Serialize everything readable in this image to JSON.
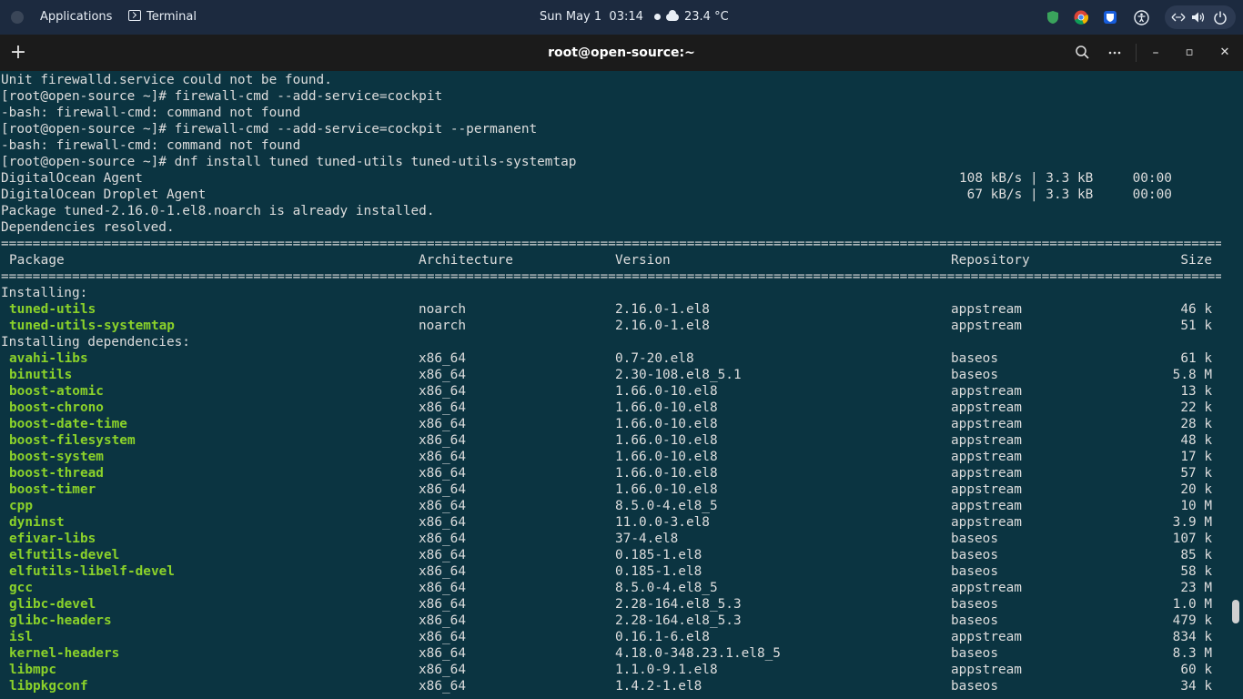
{
  "topbar": {
    "applications": "Applications",
    "terminal": "Terminal",
    "date": "Sun May 1",
    "time": "03:14",
    "weather": "23.4 °C",
    "tray_icons": [
      "shield-icon",
      "chrome-icon",
      "bitwarden-icon",
      "accessibility-icon",
      "network-icon",
      "volume-icon",
      "power-icon"
    ]
  },
  "window": {
    "title": "root@open-source:~",
    "new_tab_label": "+",
    "search_icon": "search-icon",
    "menu_icon": "kebab-menu-icon",
    "minimize": "–",
    "maximize": "▫",
    "close": "✕"
  },
  "terminal": {
    "lines": [
      "Unit firewalld.service could not be found.",
      "[root@open-source ~]# firewall-cmd --add-service=cockpit",
      "-bash: firewall-cmd: command not found",
      "[root@open-source ~]# firewall-cmd --add-service=cockpit --permanent",
      "-bash: firewall-cmd: command not found",
      "[root@open-source ~]# dnf install tuned tuned-utils tuned-utils-systemtap"
    ],
    "repo_lines": [
      {
        "name": "DigitalOcean Agent",
        "rate": "108 kB/s | 3.3 kB     00:00"
      },
      {
        "name": "DigitalOcean Droplet Agent",
        "rate": " 67 kB/s | 3.3 kB     00:00"
      }
    ],
    "status_lines": [
      "Package tuned-2.16.0-1.el8.noarch is already installed.",
      "Dependencies resolved."
    ],
    "separator": "================================================================================================================================================================",
    "headers": {
      "package": "Package",
      "arch": "Architecture",
      "version": "Version",
      "repo": "Repository",
      "size": "Size"
    },
    "section_installing": "Installing:",
    "installing": [
      {
        "name": "tuned-utils",
        "arch": "noarch",
        "version": "2.16.0-1.el8",
        "repo": "appstream",
        "size": "46 k"
      },
      {
        "name": "tuned-utils-systemtap",
        "arch": "noarch",
        "version": "2.16.0-1.el8",
        "repo": "appstream",
        "size": "51 k"
      }
    ],
    "section_deps": "Installing dependencies:",
    "deps": [
      {
        "name": "avahi-libs",
        "arch": "x86_64",
        "version": "0.7-20.el8",
        "repo": "baseos",
        "size": "61 k"
      },
      {
        "name": "binutils",
        "arch": "x86_64",
        "version": "2.30-108.el8_5.1",
        "repo": "baseos",
        "size": "5.8 M"
      },
      {
        "name": "boost-atomic",
        "arch": "x86_64",
        "version": "1.66.0-10.el8",
        "repo": "appstream",
        "size": "13 k"
      },
      {
        "name": "boost-chrono",
        "arch": "x86_64",
        "version": "1.66.0-10.el8",
        "repo": "appstream",
        "size": "22 k"
      },
      {
        "name": "boost-date-time",
        "arch": "x86_64",
        "version": "1.66.0-10.el8",
        "repo": "appstream",
        "size": "28 k"
      },
      {
        "name": "boost-filesystem",
        "arch": "x86_64",
        "version": "1.66.0-10.el8",
        "repo": "appstream",
        "size": "48 k"
      },
      {
        "name": "boost-system",
        "arch": "x86_64",
        "version": "1.66.0-10.el8",
        "repo": "appstream",
        "size": "17 k"
      },
      {
        "name": "boost-thread",
        "arch": "x86_64",
        "version": "1.66.0-10.el8",
        "repo": "appstream",
        "size": "57 k"
      },
      {
        "name": "boost-timer",
        "arch": "x86_64",
        "version": "1.66.0-10.el8",
        "repo": "appstream",
        "size": "20 k"
      },
      {
        "name": "cpp",
        "arch": "x86_64",
        "version": "8.5.0-4.el8_5",
        "repo": "appstream",
        "size": "10 M"
      },
      {
        "name": "dyninst",
        "arch": "x86_64",
        "version": "11.0.0-3.el8",
        "repo": "appstream",
        "size": "3.9 M"
      },
      {
        "name": "efivar-libs",
        "arch": "x86_64",
        "version": "37-4.el8",
        "repo": "baseos",
        "size": "107 k"
      },
      {
        "name": "elfutils-devel",
        "arch": "x86_64",
        "version": "0.185-1.el8",
        "repo": "baseos",
        "size": "85 k"
      },
      {
        "name": "elfutils-libelf-devel",
        "arch": "x86_64",
        "version": "0.185-1.el8",
        "repo": "baseos",
        "size": "58 k"
      },
      {
        "name": "gcc",
        "arch": "x86_64",
        "version": "8.5.0-4.el8_5",
        "repo": "appstream",
        "size": "23 M"
      },
      {
        "name": "glibc-devel",
        "arch": "x86_64",
        "version": "2.28-164.el8_5.3",
        "repo": "baseos",
        "size": "1.0 M"
      },
      {
        "name": "glibc-headers",
        "arch": "x86_64",
        "version": "2.28-164.el8_5.3",
        "repo": "baseos",
        "size": "479 k"
      },
      {
        "name": "isl",
        "arch": "x86_64",
        "version": "0.16.1-6.el8",
        "repo": "appstream",
        "size": "834 k"
      },
      {
        "name": "kernel-headers",
        "arch": "x86_64",
        "version": "4.18.0-348.23.1.el8_5",
        "repo": "baseos",
        "size": "8.3 M"
      },
      {
        "name": "libmpc",
        "arch": "x86_64",
        "version": "1.1.0-9.1.el8",
        "repo": "appstream",
        "size": "60 k"
      },
      {
        "name": "libpkgconf",
        "arch": "x86_64",
        "version": "1.4.2-1.el8",
        "repo": "baseos",
        "size": "34 k"
      }
    ]
  }
}
